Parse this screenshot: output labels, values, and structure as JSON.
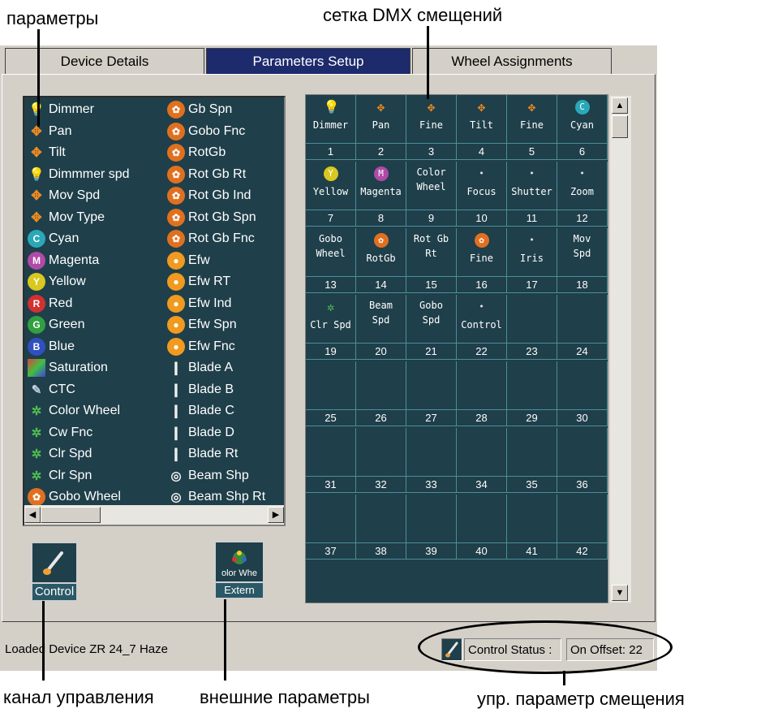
{
  "annotations": {
    "params": "параметры",
    "dmx_grid": "сетка DMX смещений",
    "control_channel": "канал управления",
    "external_params": "внешние параметры",
    "offset_control": "упр. параметр смещения"
  },
  "tabs": [
    {
      "label": "Device Details",
      "active": false
    },
    {
      "label": "Parameters Setup",
      "active": true
    },
    {
      "label": "Wheel Assignments",
      "active": false
    }
  ],
  "params_left": [
    {
      "label": "Dimmer",
      "icon": "bulb-icon"
    },
    {
      "label": "Pan",
      "icon": "pan-arrows-icon"
    },
    {
      "label": "Tilt",
      "icon": "tilt-arrows-icon"
    },
    {
      "label": "Dimmmer spd",
      "icon": "bulb-speed-icon"
    },
    {
      "label": "Mov Spd",
      "icon": "move-speed-icon"
    },
    {
      "label": "Mov Type",
      "icon": "move-type-icon"
    },
    {
      "label": "Cyan",
      "icon": "cyan-ball-icon"
    },
    {
      "label": "Magenta",
      "icon": "magenta-ball-icon"
    },
    {
      "label": "Yellow",
      "icon": "yellow-ball-icon"
    },
    {
      "label": "Red",
      "icon": "red-ball-icon"
    },
    {
      "label": "Green",
      "icon": "green-ball-icon"
    },
    {
      "label": "Blue",
      "icon": "blue-ball-icon"
    },
    {
      "label": "Saturation",
      "icon": "saturation-icon"
    },
    {
      "label": "CTC",
      "icon": "ctc-icon"
    },
    {
      "label": "Color Wheel",
      "icon": "color-wheel-icon"
    },
    {
      "label": "Cw Fnc",
      "icon": "color-wheel-function-icon"
    },
    {
      "label": "Clr Spd",
      "icon": "color-speed-icon"
    },
    {
      "label": "Clr Spn",
      "icon": "color-spin-icon"
    },
    {
      "label": "Gobo Wheel",
      "icon": "gobo-wheel-icon"
    }
  ],
  "params_right": [
    {
      "label": "Gb Spn",
      "icon": "gobo-spin-icon"
    },
    {
      "label": "Gobo Fnc",
      "icon": "gobo-function-icon"
    },
    {
      "label": "RotGb",
      "icon": "rotating-gobo-icon"
    },
    {
      "label": "Rot Gb Rt",
      "icon": "rot-gobo-rate-icon"
    },
    {
      "label": "Rot Gb Ind",
      "icon": "rot-gobo-index-icon"
    },
    {
      "label": "Rot Gb Spn",
      "icon": "rot-gobo-spin-icon"
    },
    {
      "label": "Rot Gb Fnc",
      "icon": "rot-gobo-function-icon"
    },
    {
      "label": "Efw",
      "icon": "effect-wheel-icon"
    },
    {
      "label": "Efw RT",
      "icon": "effect-wheel-rate-icon"
    },
    {
      "label": "Efw Ind",
      "icon": "effect-wheel-index-icon"
    },
    {
      "label": "Efw Spn",
      "icon": "effect-wheel-spin-icon"
    },
    {
      "label": "Efw Fnc",
      "icon": "effect-wheel-function-icon"
    },
    {
      "label": "Blade A",
      "icon": "blade-a-icon"
    },
    {
      "label": "Blade B",
      "icon": "blade-b-icon"
    },
    {
      "label": "Blade C",
      "icon": "blade-c-icon"
    },
    {
      "label": "Blade D",
      "icon": "blade-d-icon"
    },
    {
      "label": "Blade Rt",
      "icon": "blade-rotate-icon"
    },
    {
      "label": "Beam Shp",
      "icon": "beam-shape-icon"
    },
    {
      "label": "Beam Shp Rt",
      "icon": "beam-shape-rotate-icon"
    }
  ],
  "grid_rows": [
    {
      "cells": [
        {
          "l1": "Dimmer",
          "l2": "",
          "icon": "bulb-icon"
        },
        {
          "l1": "Pan",
          "l2": "",
          "icon": "pan-arrows-icon"
        },
        {
          "l1": "Fine",
          "l2": "",
          "icon": "pan-arrows-icon"
        },
        {
          "l1": "Tilt",
          "l2": "",
          "icon": "tilt-arrows-icon"
        },
        {
          "l1": "Fine",
          "l2": "",
          "icon": "tilt-arrows-icon"
        },
        {
          "l1": "Cyan",
          "l2": "",
          "icon": "cyan-ball-icon"
        }
      ],
      "nums": [
        "1",
        "2",
        "3",
        "4",
        "5",
        "6"
      ]
    },
    {
      "cells": [
        {
          "l1": "Yellow",
          "l2": "",
          "icon": "yellow-ball-icon"
        },
        {
          "l1": "Magenta",
          "l2": "",
          "icon": "magenta-ball-icon"
        },
        {
          "l1": "Color",
          "l2": "Wheel",
          "icon": ""
        },
        {
          "l1": "Focus",
          "l2": "",
          "icon": "focus-icon"
        },
        {
          "l1": "Shutter",
          "l2": "",
          "icon": "shutter-icon"
        },
        {
          "l1": "Zoom",
          "l2": "",
          "icon": "zoom-icon"
        }
      ],
      "nums": [
        "7",
        "8",
        "9",
        "10",
        "11",
        "12"
      ]
    },
    {
      "cells": [
        {
          "l1": "Gobo",
          "l2": "Wheel",
          "icon": ""
        },
        {
          "l1": "RotGb",
          "l2": "",
          "icon": "rotating-gobo-icon"
        },
        {
          "l1": "Rot Gb",
          "l2": "Rt",
          "icon": ""
        },
        {
          "l1": "Fine",
          "l2": "",
          "icon": "rot-gobo-rate-icon"
        },
        {
          "l1": "Iris",
          "l2": "",
          "icon": "iris-icon"
        },
        {
          "l1": "Mov",
          "l2": "Spd",
          "icon": ""
        }
      ],
      "nums": [
        "13",
        "14",
        "15",
        "16",
        "17",
        "18"
      ]
    },
    {
      "cells": [
        {
          "l1": "Clr Spd",
          "l2": "",
          "icon": "color-speed-icon"
        },
        {
          "l1": "Beam",
          "l2": "Spd",
          "icon": ""
        },
        {
          "l1": "Gobo",
          "l2": "Spd",
          "icon": ""
        },
        {
          "l1": "Control",
          "l2": "",
          "icon": "control-brush-icon"
        },
        {
          "l1": "",
          "l2": "",
          "icon": ""
        },
        {
          "l1": "",
          "l2": "",
          "icon": ""
        }
      ],
      "nums": [
        "19",
        "20",
        "21",
        "22",
        "23",
        "24"
      ]
    },
    {
      "cells": [],
      "nums": [
        "25",
        "26",
        "27",
        "28",
        "29",
        "30"
      ]
    },
    {
      "cells": [],
      "nums": [
        "31",
        "32",
        "33",
        "34",
        "35",
        "36"
      ]
    },
    {
      "cells": [],
      "nums": [
        "37",
        "38",
        "39",
        "40",
        "41",
        "42"
      ]
    }
  ],
  "control_button": {
    "label": "Control",
    "icon": "control-brush-icon"
  },
  "external_button": {
    "label_top": "olor Whe",
    "label": "Extern",
    "icon": "color-wheel-icon"
  },
  "status": {
    "loaded": "Loaded Device ZR 24_7 Haze",
    "control_status": "Control Status :",
    "offset": "On Offset: 22"
  },
  "colors": {
    "panel": "#d4d0c8",
    "dark_teal": "#1f3f4a",
    "grid_line": "#4c8f99",
    "active_tab": "#1d2a6c"
  }
}
